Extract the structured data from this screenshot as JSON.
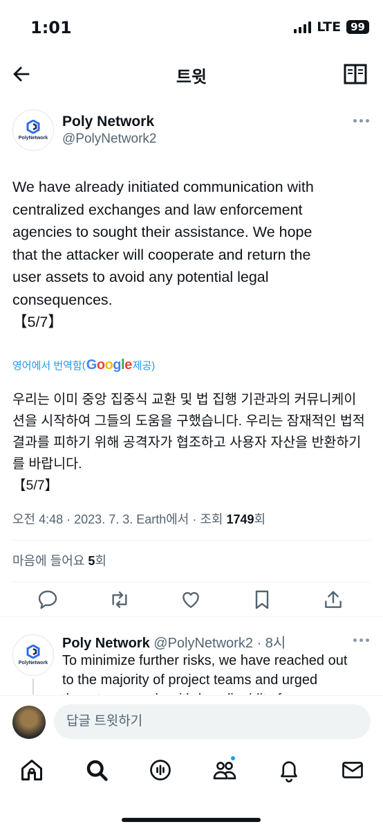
{
  "status": {
    "time": "1:01",
    "network": "LTE",
    "battery": "99"
  },
  "header": {
    "title": "트윗"
  },
  "tweet": {
    "author_name": "Poly Network",
    "author_handle": "@PolyNetwork2",
    "avatar_logo_text": "PolyNetwork",
    "text": "We have already initiated communication with\ncentralized exchanges and law enforcement\nagencies to sought their assistance. We hope\nthat the attacker will cooperate and return the\nuser assets to avoid any potential legal\nconsequences.\n【5/7】",
    "translated_prefix": "영어에서 번역함",
    "translated_brand": "Google",
    "translated_suffix": " 제공)",
    "translation": "우리는 이미 중앙 집중식 교환 및 법 집행 기관과의 커뮤니케이\n션을 시작하여 그들의 도움을 구했습니다. 우리는 잠재적인 법적\n결과를 피하기 위해 공격자가 협조하고 사용자 자산을 반환하기\n를 바랍니다.\n【5/7】",
    "meta_prefix": "오전 4:48 · 2023. 7. 3. Earth에서 · 조회 ",
    "views": "1749",
    "views_suffix": "회",
    "likes_prefix": "마음에 들어요 ",
    "likes": "5",
    "likes_suffix": "회"
  },
  "reply": {
    "author_name": "Poly Network",
    "meta": " @PolyNetwork2 · 8시",
    "text": "To minimize further risks, we have reached out\nto the majority of project teams and urged\nthem to promptly withdraw liquidity from",
    "avatar_logo_text": "PolyNetwork"
  },
  "composer": {
    "placeholder": "답글 트윗하기"
  },
  "icons": {
    "back": "back-arrow-icon",
    "reader": "reader-mode-icon",
    "reply": "reply-icon",
    "retweet": "retweet-icon",
    "like": "heart-icon",
    "bookmark": "bookmark-icon",
    "share": "share-icon",
    "home": "home-icon",
    "search": "search-icon",
    "spaces": "spaces-icon",
    "communities": "communities-icon",
    "notifications": "bell-icon",
    "messages": "mail-icon"
  },
  "colors": {
    "accent": "#1d9bf0",
    "text": "#0f1419",
    "secondary": "#536471"
  }
}
